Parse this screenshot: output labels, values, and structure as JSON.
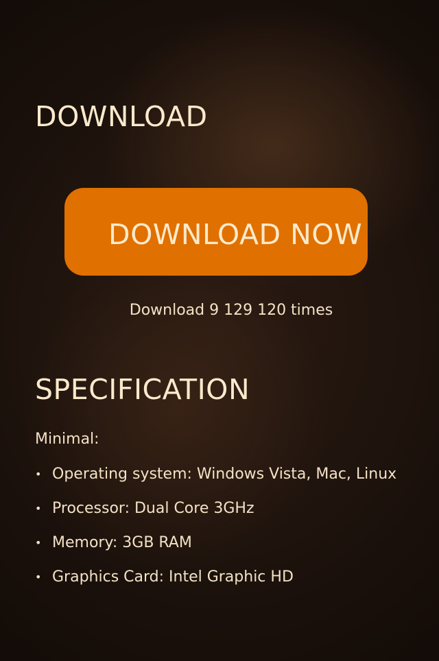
{
  "download": {
    "title": "DOWNLOAD",
    "button_label": "DOWNLOAD NOW",
    "count_text": "Download 9 129 120 times"
  },
  "specification": {
    "title": "SPECIFICATION",
    "subtitle": "Minimal:",
    "items": [
      "Operating system: Windows Vista, Mac, Linux",
      "Processor: Dual Core 3GHz",
      "Memory: 3GB RAM",
      "Graphics Card: Intel Graphic HD"
    ]
  },
  "colors": {
    "accent": "#e07000",
    "text": "#f6e7cf",
    "background": "#1e130d"
  }
}
